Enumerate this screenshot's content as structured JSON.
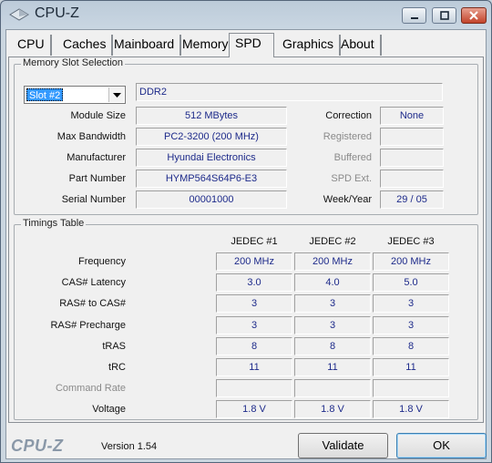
{
  "window": {
    "title": "CPU-Z",
    "controls": [
      "minimize",
      "maximize",
      "close"
    ]
  },
  "tabs": [
    {
      "label": "CPU",
      "active": false
    },
    {
      "label": "Caches",
      "active": false
    },
    {
      "label": "Mainboard",
      "active": false
    },
    {
      "label": "Memory",
      "active": false
    },
    {
      "label": "SPD",
      "active": true
    },
    {
      "label": "Graphics",
      "active": false
    },
    {
      "label": "About",
      "active": false
    }
  ],
  "memory_slot": {
    "group_title": "Memory Slot Selection",
    "slot_selected": "Slot #2",
    "memory_type": "DDR2",
    "fields": {
      "module_size": {
        "label": "Module Size",
        "value": "512 MBytes"
      },
      "max_bandwidth": {
        "label": "Max Bandwidth",
        "value": "PC2-3200 (200 MHz)"
      },
      "manufacturer": {
        "label": "Manufacturer",
        "value": "Hyundai Electronics"
      },
      "part_number": {
        "label": "Part Number",
        "value": "HYMP564S64P6-E3"
      },
      "serial_number": {
        "label": "Serial Number",
        "value": "00001000"
      },
      "correction": {
        "label": "Correction",
        "value": "None"
      },
      "registered": {
        "label": "Registered",
        "value": ""
      },
      "buffered": {
        "label": "Buffered",
        "value": ""
      },
      "spd_ext": {
        "label": "SPD Ext.",
        "value": ""
      },
      "week_year": {
        "label": "Week/Year",
        "value": "29 / 05"
      }
    }
  },
  "timings": {
    "group_title": "Timings Table",
    "columns": [
      "JEDEC #1",
      "JEDEC #2",
      "JEDEC #3"
    ],
    "rows": [
      {
        "label": "Frequency",
        "enabled": true,
        "values": [
          "200 MHz",
          "200 MHz",
          "200 MHz"
        ]
      },
      {
        "label": "CAS# Latency",
        "enabled": true,
        "values": [
          "3.0",
          "4.0",
          "5.0"
        ]
      },
      {
        "label": "RAS# to CAS#",
        "enabled": true,
        "values": [
          "3",
          "3",
          "3"
        ]
      },
      {
        "label": "RAS# Precharge",
        "enabled": true,
        "values": [
          "3",
          "3",
          "3"
        ]
      },
      {
        "label": "tRAS",
        "enabled": true,
        "values": [
          "8",
          "8",
          "8"
        ]
      },
      {
        "label": "tRC",
        "enabled": true,
        "values": [
          "11",
          "11",
          "11"
        ]
      },
      {
        "label": "Command Rate",
        "enabled": false,
        "values": [
          "",
          "",
          ""
        ]
      },
      {
        "label": "Voltage",
        "enabled": true,
        "values": [
          "1.8 V",
          "1.8 V",
          "1.8 V"
        ]
      }
    ]
  },
  "footer": {
    "brand": "CPU-Z",
    "version": "Version 1.54",
    "validate_label": "Validate",
    "ok_label": "OK"
  },
  "colors": {
    "value_text": "#1d2a8a",
    "disabled_label": "#8a8a8a",
    "selection": "#3399ff"
  }
}
